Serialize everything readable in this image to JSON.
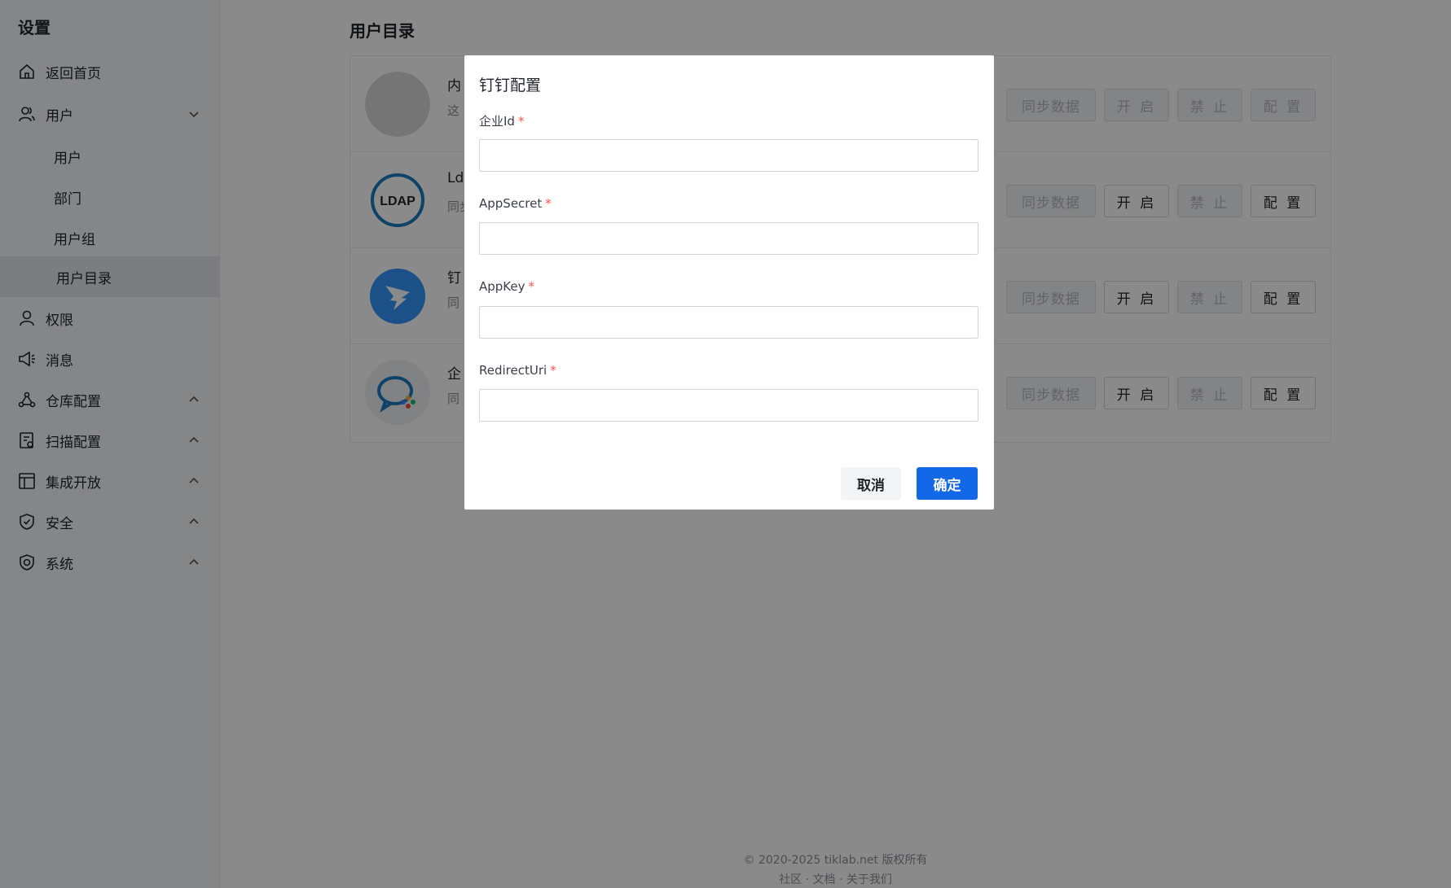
{
  "sidebar": {
    "title": "设置",
    "items": [
      {
        "label": "返回首页"
      },
      {
        "label": "用户"
      },
      {
        "label": "用户"
      },
      {
        "label": "部门"
      },
      {
        "label": "用户组"
      },
      {
        "label": "用户目录"
      },
      {
        "label": "权限"
      },
      {
        "label": "消息"
      },
      {
        "label": "仓库配置"
      },
      {
        "label": "扫描配置"
      },
      {
        "label": "集成开放"
      },
      {
        "label": "安全"
      },
      {
        "label": "系统"
      }
    ]
  },
  "main": {
    "title": "用户目录",
    "directories": [
      {
        "name": "内",
        "desc": "这",
        "logo": "LDAP"
      },
      {
        "name": "Lda",
        "desc": "同步"
      },
      {
        "name": "钉",
        "desc": "同"
      },
      {
        "name": "企",
        "desc": "同"
      }
    ],
    "buttons": {
      "sync": "同步数据",
      "enable": "开 启",
      "disable": "禁 止",
      "config": "配 置"
    }
  },
  "footer": {
    "copyright": "© 2020-2025 tiklab.net 版权所有",
    "links": "社区 · 文档 · 关于我们"
  },
  "modal": {
    "title": "钉钉配置",
    "fields": [
      {
        "label": "企业Id",
        "value": ""
      },
      {
        "label": "AppSecret",
        "value": ""
      },
      {
        "label": "AppKey",
        "value": ""
      },
      {
        "label": "RedirectUri",
        "value": ""
      }
    ],
    "required_mark": "*",
    "cancel": "取消",
    "ok": "确定"
  },
  "colors": {
    "primary": "#1368e8",
    "required": "#ff4d4f",
    "ldap": "#1a7bbf",
    "dingtalk": "#3296fa"
  }
}
